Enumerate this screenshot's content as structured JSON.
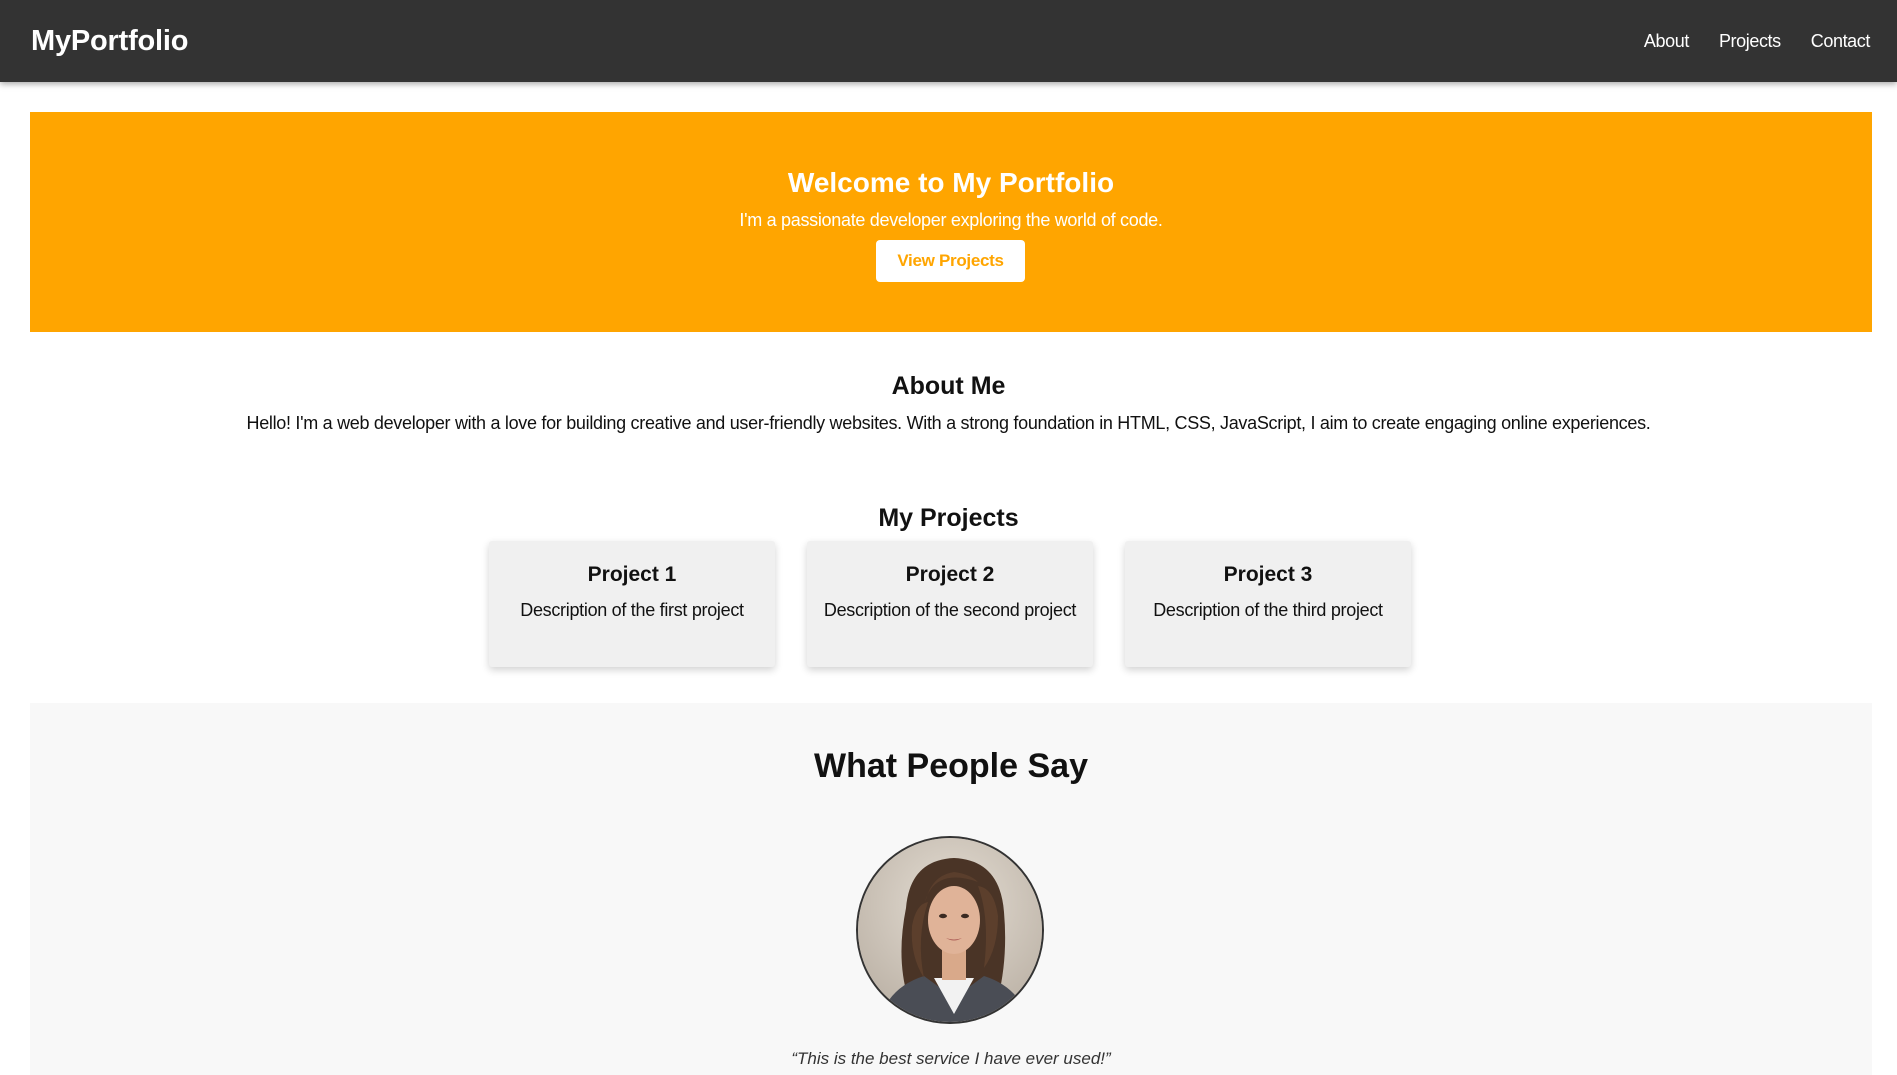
{
  "navbar": {
    "brand": "MyPortfolio",
    "links": [
      "About",
      "Projects",
      "Contact"
    ]
  },
  "hero": {
    "title": "Welcome to My Portfolio",
    "subtitle": "I'm a passionate developer exploring the world of code.",
    "button_label": "View Projects"
  },
  "about": {
    "title": "About Me",
    "text": "Hello! I'm a web developer with a love for building creative and user-friendly websites. With a strong foundation in HTML, CSS, JavaScript, I aim to create engaging online experiences."
  },
  "projects": {
    "title": "My Projects",
    "items": [
      {
        "title": "Project 1",
        "description": "Description of the first project"
      },
      {
        "title": "Project 2",
        "description": "Description of the second project"
      },
      {
        "title": "Project 3",
        "description": "Description of the third project"
      }
    ]
  },
  "testimonials": {
    "title": "What People Say",
    "quote": "“This is the best service I have ever used!”"
  },
  "colors": {
    "navbar_bg": "#333333",
    "accent": "#ffa500",
    "card_bg": "#f0f0f0",
    "testimonial_bg": "#f8f8f8"
  }
}
